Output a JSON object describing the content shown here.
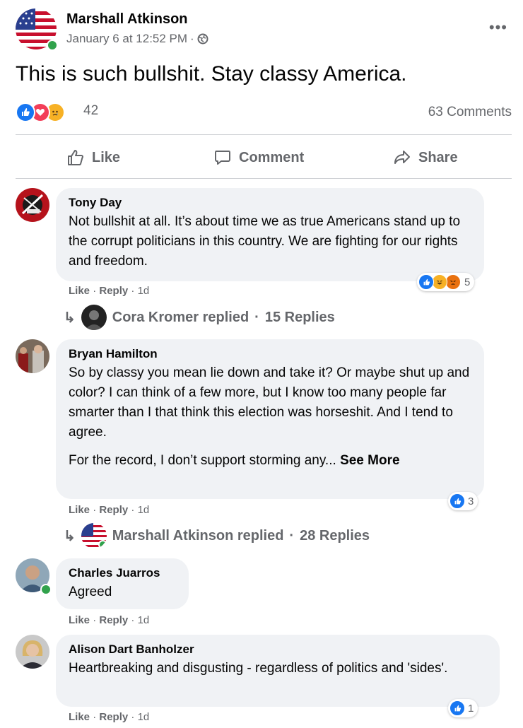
{
  "post": {
    "author": "Marshall Atkinson",
    "date": "January 6 at 12:52 PM",
    "meta_separator": "·",
    "text": "This is such bullshit. Stay classy America.",
    "reactions": {
      "icons": [
        "like-icon",
        "love-icon",
        "sad-icon"
      ],
      "count": "42"
    },
    "comments_count": "63 Comments"
  },
  "actions": {
    "like": "Like",
    "comment": "Comment",
    "share": "Share"
  },
  "comments": [
    {
      "author": "Tony Day",
      "text": "Not bullshit at all. It’s about time we as true Americans stand up to the corrupt politicians in this country. We are fighting for our rights and freedom.",
      "like": "Like",
      "reply": "Reply",
      "time": "1d",
      "reactions": {
        "icons": [
          "like-icon",
          "haha-icon",
          "angry-icon"
        ],
        "count": "5"
      },
      "replies": {
        "name": "Cora Kromer replied",
        "count": "15 Replies"
      }
    },
    {
      "author": "Bryan Hamilton",
      "text": "So by classy you mean lie down and take it? Or maybe shut up and color? I can think of a few more, but I know too many people far smarter than I that think this election was horseshit. And I tend to agree.",
      "text2": "For the record, I don’t support storming any...",
      "see_more": "See More",
      "like": "Like",
      "reply": "Reply",
      "time": "1d",
      "reactions": {
        "icons": [
          "like-icon"
        ],
        "count": "3"
      },
      "replies": {
        "name": "Marshall Atkinson replied",
        "count": "28 Replies"
      }
    },
    {
      "author": "Charles Juarros",
      "text": "Agreed",
      "like": "Like",
      "reply": "Reply",
      "time": "1d"
    },
    {
      "author": "Alison Dart Banholzer",
      "text": "Heartbreaking and disgusting - regardless of politics and 'sides'.",
      "like": "Like",
      "reply": "Reply",
      "time": "1d",
      "reactions": {
        "icons": [
          "like-icon"
        ],
        "count": "1"
      }
    }
  ],
  "colors": {
    "like_blue": "#1877f2",
    "love_red": "#f33e58",
    "sad_yellow": "#f7b125",
    "angry_orange": "#e9710f",
    "online_green": "#31a24c",
    "secondary_text": "#65676b",
    "bubble_bg": "#f0f2f5"
  }
}
